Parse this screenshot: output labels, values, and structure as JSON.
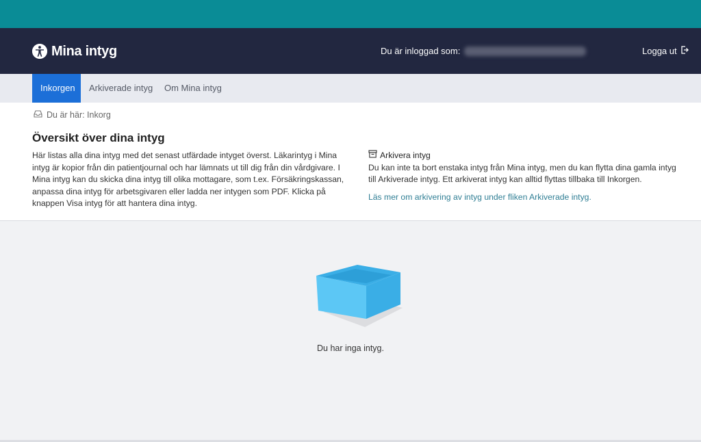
{
  "header": {
    "logo_text": "Mina intyg",
    "login_label": "Du är inloggad som:",
    "logout_label": "Logga ut"
  },
  "nav": {
    "tabs": [
      {
        "label": "Inkorgen",
        "active": true
      },
      {
        "label": "Arkiverade intyg",
        "active": false
      },
      {
        "label": "Om Mina intyg",
        "active": false
      }
    ]
  },
  "breadcrumb": {
    "text": "Du är här: Inkorg"
  },
  "intro": {
    "title": "Översikt över dina intyg",
    "text": "Här listas alla dina intyg med det senast utfärdade intyget överst. Läkarintyg i Mina intyg är kopior från din patientjournal och har lämnats ut till dig från din vårdgivare. I Mina intyg kan du skicka dina intyg till olika mottagare, som t.ex. Försäkringskassan, anpassa dina intyg för arbetsgivaren eller ladda ner intygen som PDF. Klicka på knappen Visa intyg för att hantera dina intyg."
  },
  "archive": {
    "title": "Arkivera intyg",
    "text": "Du kan inte ta bort enstaka intyg från Mina intyg, men du kan flytta dina gamla intyg till Arkiverade intyg. Ett arkiverat intyg kan alltid flyttas tillbaka till Inkorgen.",
    "link": "Läs mer om arkivering av intyg under fliken Arkiverade intyg."
  },
  "empty_state": {
    "text": "Du har inga intyg."
  },
  "colors": {
    "topbar": "#0a8c96",
    "header": "#222740",
    "active_tab": "#1c6fd8",
    "link": "#2f7e94",
    "box_light": "#5cc7f5",
    "box_dark": "#3aaee6"
  }
}
